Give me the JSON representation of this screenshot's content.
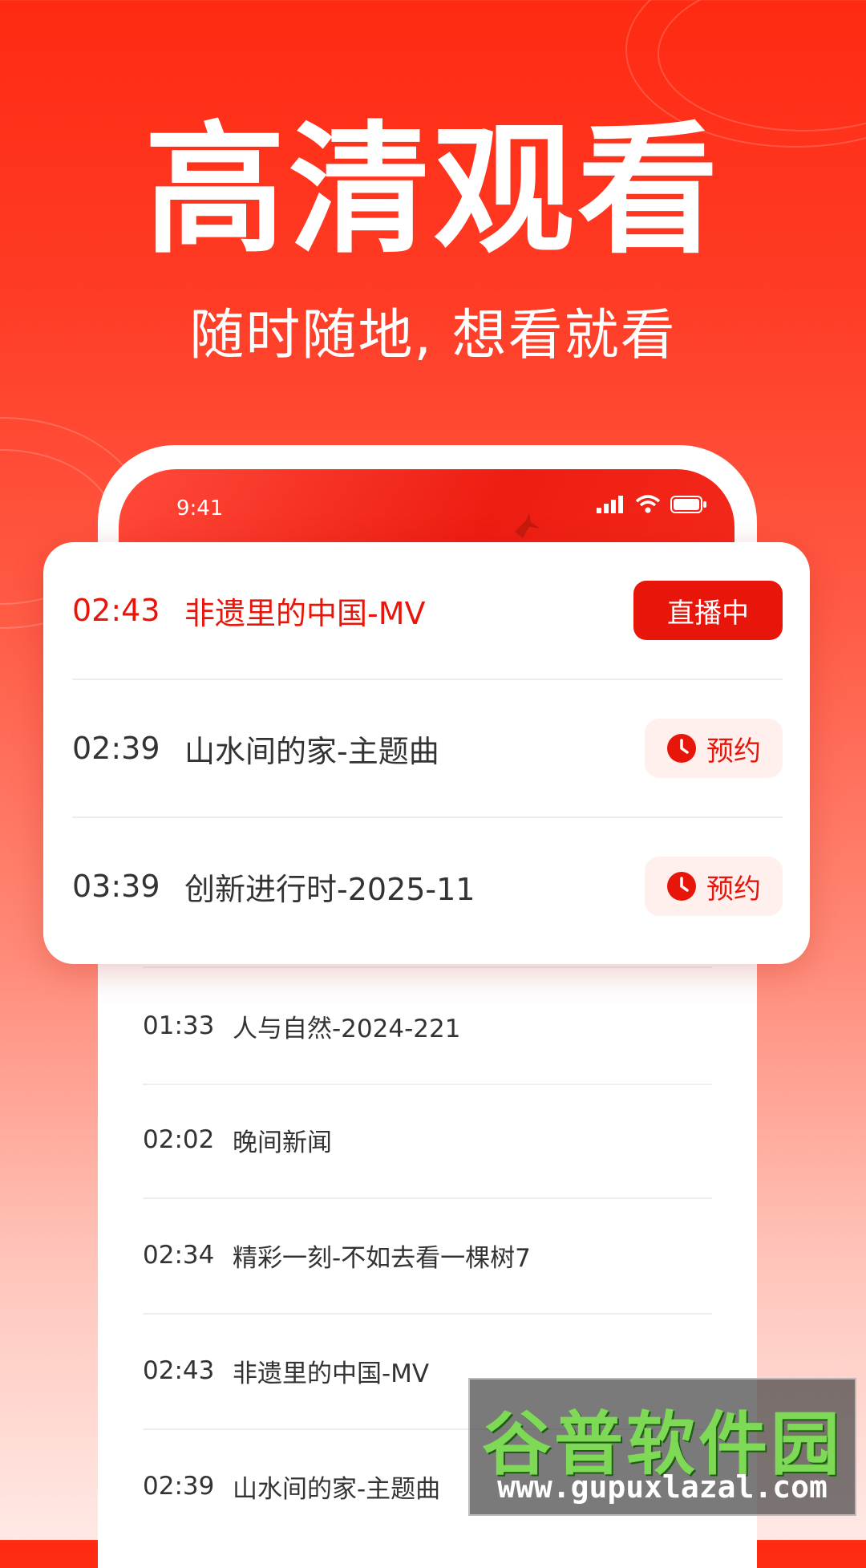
{
  "hero": {
    "headline": "高清观看",
    "subtitle": "随时随地, 想看就看"
  },
  "phone": {
    "status_time": "9:41",
    "icons": [
      "signal-icon",
      "wifi-icon",
      "battery-icon"
    ]
  },
  "featured": [
    {
      "time": "02:43",
      "title": "非遗里的中国-MV",
      "action": "直播中",
      "state": "live"
    },
    {
      "time": "02:39",
      "title": "山水间的家-主题曲",
      "action": "预约",
      "state": "reserve"
    },
    {
      "time": "03:39",
      "title": "创新进行时-2025-11",
      "action": "预约",
      "state": "reserve"
    }
  ],
  "schedule": [
    {
      "time": "01:33",
      "title": "人与自然-2024-221"
    },
    {
      "time": "02:02",
      "title": "晚间新闻"
    },
    {
      "time": "02:34",
      "title": "精彩一刻-不如去看一棵树7"
    },
    {
      "time": "02:43",
      "title": "非遗里的中国-MV"
    },
    {
      "time": "02:39",
      "title": "山水间的家-主题曲"
    }
  ],
  "watermark": {
    "brand": "谷普软件园",
    "url": "www.gupuxlazal.com"
  },
  "colors": {
    "accent": "#e8150a",
    "reserve_bg": "#fff0ee"
  }
}
